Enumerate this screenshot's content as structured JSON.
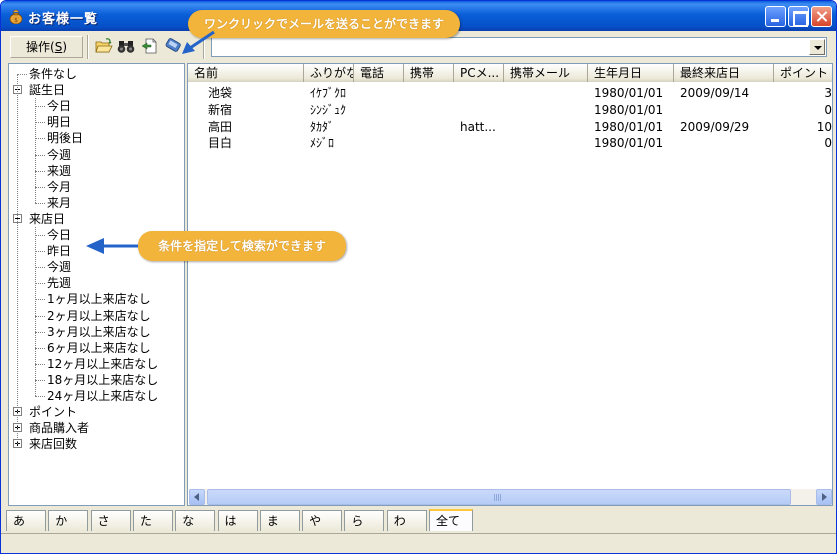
{
  "window": {
    "title": "お客様一覧"
  },
  "toolbar": {
    "op_menu_label": "操作(",
    "op_menu_key": "S",
    "op_menu_close": ")",
    "search_value": ""
  },
  "tree": {
    "items": [
      {
        "label": "条件なし",
        "level": 0,
        "expander": "none"
      },
      {
        "label": "誕生日",
        "level": 0,
        "expander": "minus"
      },
      {
        "label": "今日",
        "level": 1
      },
      {
        "label": "明日",
        "level": 1
      },
      {
        "label": "明後日",
        "level": 1
      },
      {
        "label": "今週",
        "level": 1
      },
      {
        "label": "来週",
        "level": 1
      },
      {
        "label": "今月",
        "level": 1
      },
      {
        "label": "来月",
        "level": 1
      },
      {
        "label": "来店日",
        "level": 0,
        "expander": "minus"
      },
      {
        "label": "今日",
        "level": 1
      },
      {
        "label": "昨日",
        "level": 1
      },
      {
        "label": "今週",
        "level": 1
      },
      {
        "label": "先週",
        "level": 1
      },
      {
        "label": "1ヶ月以上来店なし",
        "level": 1
      },
      {
        "label": "2ヶ月以上来店なし",
        "level": 1
      },
      {
        "label": "3ヶ月以上来店なし",
        "level": 1
      },
      {
        "label": "6ヶ月以上来店なし",
        "level": 1
      },
      {
        "label": "12ヶ月以上来店なし",
        "level": 1
      },
      {
        "label": "18ヶ月以上来店なし",
        "level": 1
      },
      {
        "label": "24ヶ月以上来店なし",
        "level": 1
      },
      {
        "label": "ポイント",
        "level": 0,
        "expander": "plus"
      },
      {
        "label": "商品購入者",
        "level": 0,
        "expander": "plus"
      },
      {
        "label": "来店回数",
        "level": 0,
        "expander": "plus"
      }
    ]
  },
  "list": {
    "columns": [
      "名前",
      "ふりがな",
      "電話",
      "携帯",
      "PCメ...",
      "携帯メール",
      "生年月日",
      "最終来店日",
      "ポイント"
    ],
    "rows": [
      [
        "池袋",
        "ｲｹﾌﾞｸﾛ",
        "",
        "",
        "",
        "",
        "1980/01/01",
        "2009/09/14",
        "3"
      ],
      [
        "新宿",
        "ｼﾝｼﾞｭｸ",
        "",
        "",
        "",
        "",
        "1980/01/01",
        "",
        "0"
      ],
      [
        "高田",
        "ﾀｶﾀﾞ",
        "",
        "",
        "hatt...",
        "",
        "1980/01/01",
        "2009/09/29",
        "10"
      ],
      [
        "目白",
        "ﾒｼﾞﾛ",
        "",
        "",
        "",
        "",
        "1980/01/01",
        "",
        "0"
      ]
    ]
  },
  "tabs": [
    "あ",
    "か",
    "さ",
    "た",
    "な",
    "は",
    "ま",
    "や",
    "ら",
    "わ",
    "全て"
  ],
  "active_tab": "全て",
  "callouts": {
    "top": "ワンクリックでメールを送ることができます",
    "middle": "条件を指定して検索ができます"
  },
  "colors": {
    "title_bar": "#0a5fd8",
    "callout": "#f2b43b",
    "arrow": "#2463c8"
  }
}
